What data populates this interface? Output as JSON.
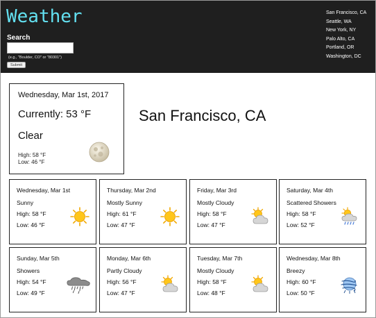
{
  "header": {
    "logo": "Weather",
    "search_label": "Search",
    "search_value": "",
    "search_hint": "(e.g., \"Boulder, CO\" or \"80301\")",
    "submit_label": "Submit",
    "cities": [
      "San Francisco, CA",
      "Seattle, WA",
      "New York, NY",
      "Palo Alto, CA",
      "Portland, OR",
      "Washington, DC"
    ]
  },
  "current": {
    "date": "Wednesday, Mar 1st, 2017",
    "temp": "Currently: 53 °F",
    "condition": "Clear",
    "high": "High: 58 °F",
    "low": "Low: 46 °F",
    "icon": "moon-icon"
  },
  "location": "San Francisco, CA",
  "forecast": [
    {
      "date": "Wednesday, Mar 1st",
      "condition": "Sunny",
      "high": "High: 58 °F",
      "low": "Low: 46 °F",
      "icon": "sun-icon"
    },
    {
      "date": "Thursday, Mar 2nd",
      "condition": "Mostly Sunny",
      "high": "High: 61 °F",
      "low": "Low: 47 °F",
      "icon": "sun-icon"
    },
    {
      "date": "Friday, Mar 3rd",
      "condition": "Mostly Cloudy",
      "high": "High: 58 °F",
      "low": "Low: 47 °F",
      "icon": "partly-cloudy-icon"
    },
    {
      "date": "Saturday, Mar 4th",
      "condition": "Scattered Showers",
      "high": "High: 58 °F",
      "low": "Low: 52 °F",
      "icon": "showers-icon"
    },
    {
      "date": "Sunday, Mar 5th",
      "condition": "Showers",
      "high": "High: 54 °F",
      "low": "Low: 49 °F",
      "icon": "rain-icon"
    },
    {
      "date": "Monday, Mar 6th",
      "condition": "Partly Cloudy",
      "high": "High: 56 °F",
      "low": "Low: 47 °F",
      "icon": "partly-cloudy-icon"
    },
    {
      "date": "Tuesday, Mar 7th",
      "condition": "Mostly Cloudy",
      "high": "High: 58 °F",
      "low": "Low: 48 °F",
      "icon": "partly-cloudy-icon"
    },
    {
      "date": "Wednesday, Mar 8th",
      "condition": "Breezy",
      "high": "High: 60 °F",
      "low": "Low: 50 °F",
      "icon": "wind-icon"
    }
  ],
  "colors": {
    "header_bg": "#1f1f1f",
    "logo": "#63e0f0",
    "sun": "#f7b500",
    "cloud": "#c9c9c9"
  }
}
